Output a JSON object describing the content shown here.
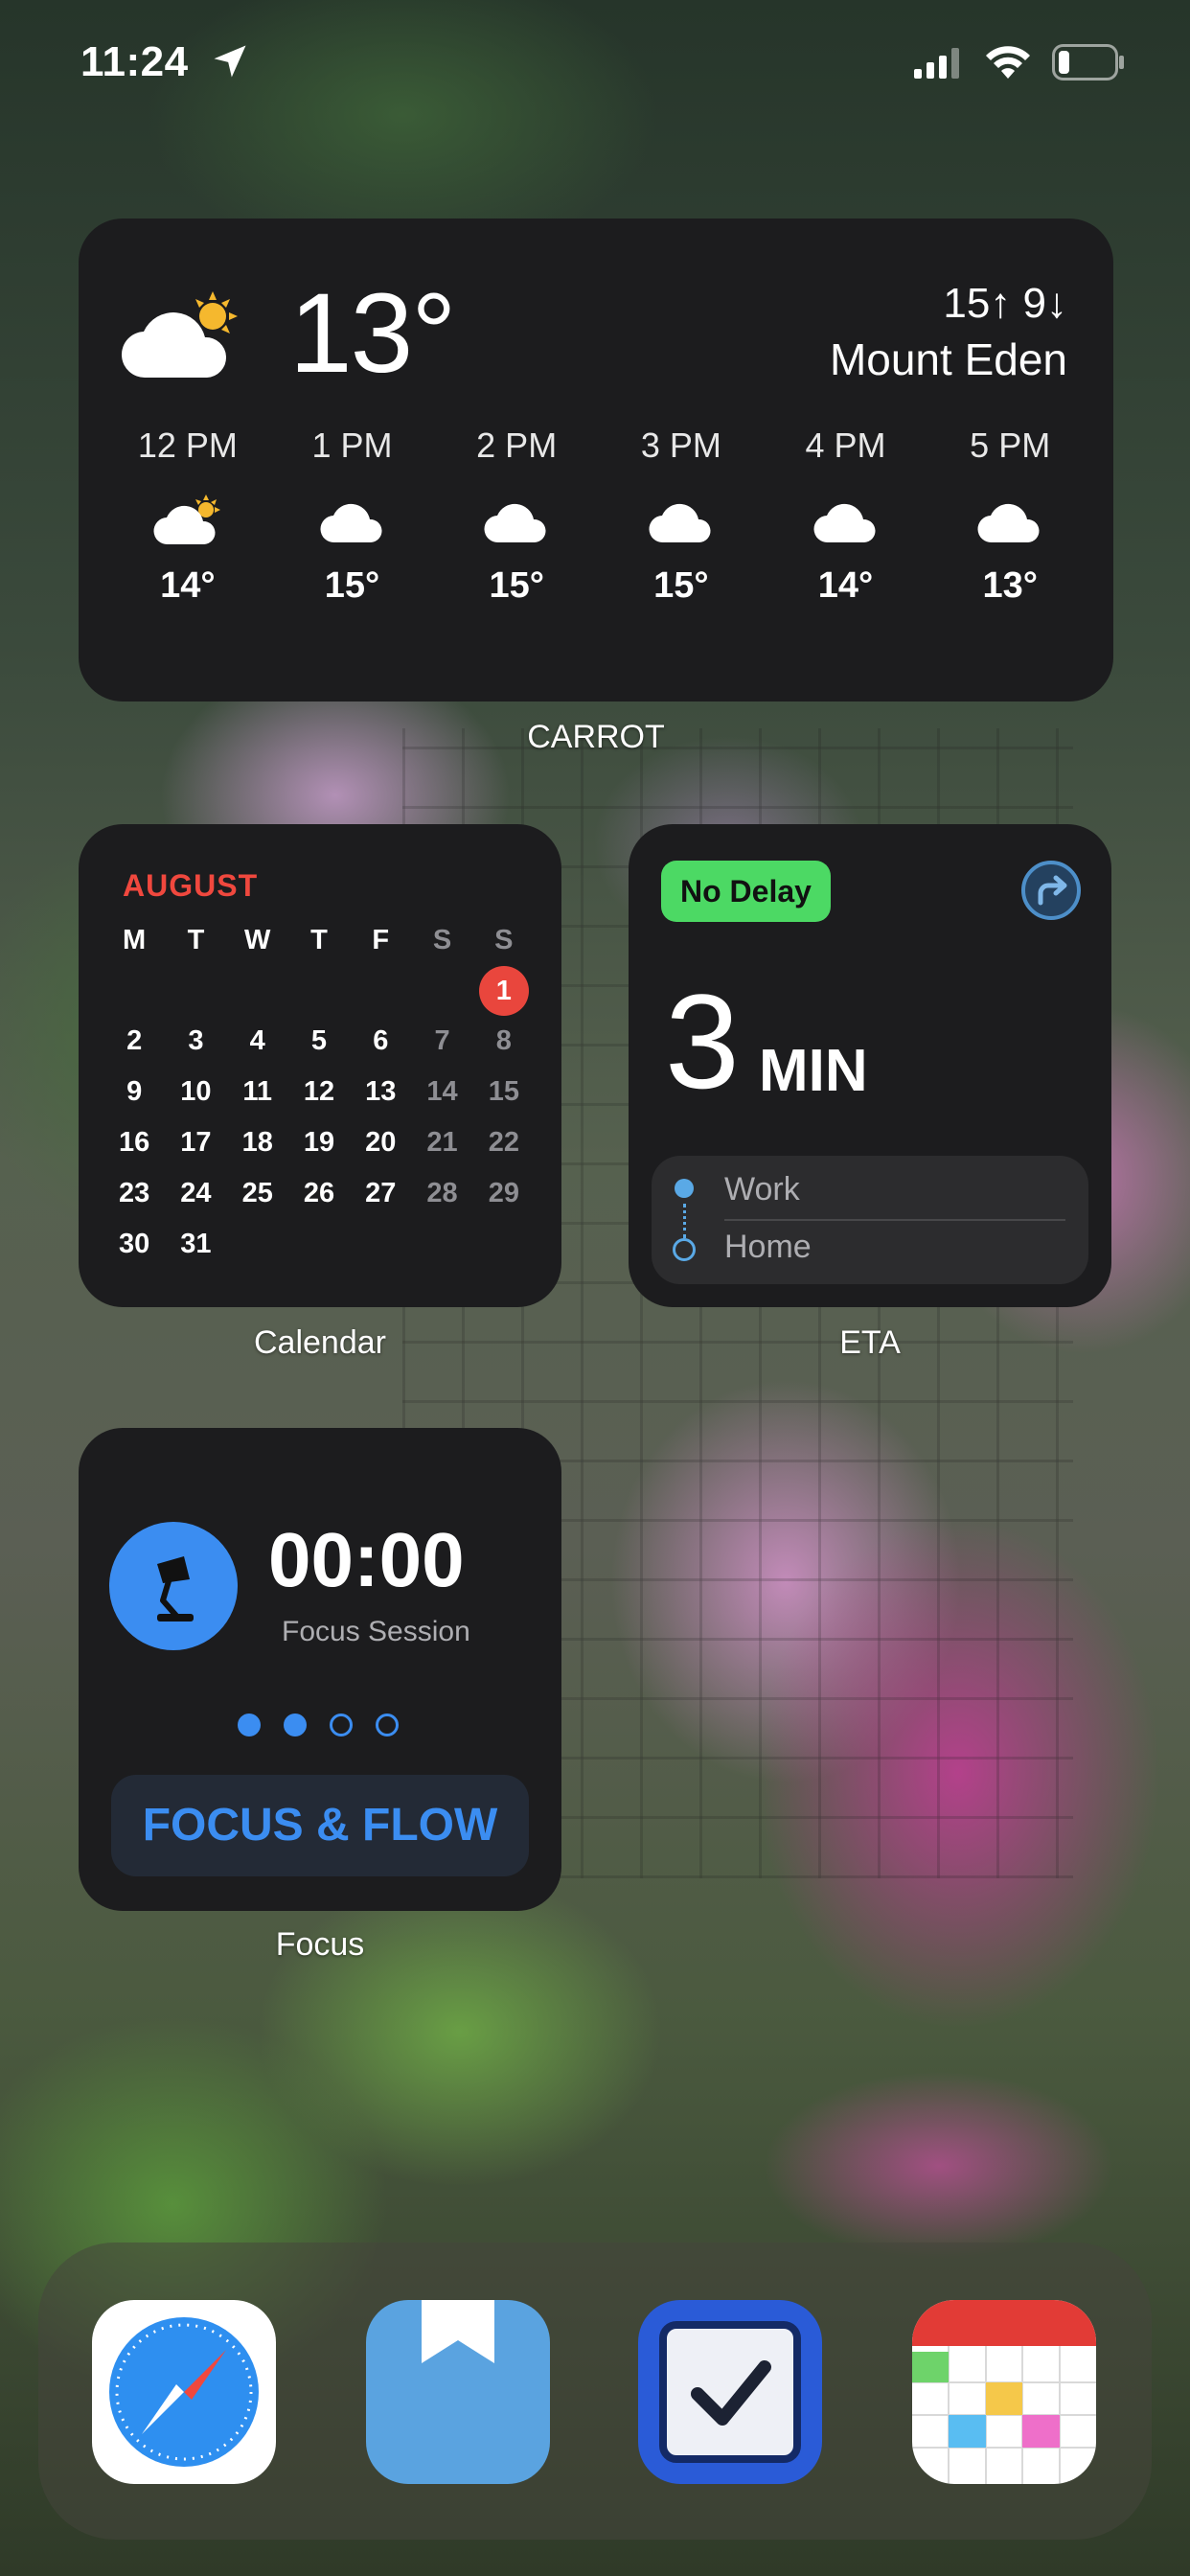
{
  "status_bar": {
    "time": "11:24",
    "location_icon": "location-arrow-icon",
    "signal_icon": "cellular-signal-icon",
    "wifi_icon": "wifi-icon",
    "battery_icon": "battery-low-icon"
  },
  "weather": {
    "app_label": "CARROT",
    "current_temp": "13°",
    "high_low": "15↑ 9↓",
    "location": "Mount Eden",
    "current_icon": "partly-cloudy-day-icon",
    "hours": [
      {
        "time": "12 PM",
        "icon": "partly-cloudy-day-icon",
        "temp": "14°"
      },
      {
        "time": "1 PM",
        "icon": "cloud-icon",
        "temp": "15°"
      },
      {
        "time": "2 PM",
        "icon": "cloud-icon",
        "temp": "15°"
      },
      {
        "time": "3 PM",
        "icon": "cloud-icon",
        "temp": "15°"
      },
      {
        "time": "4 PM",
        "icon": "cloud-icon",
        "temp": "14°"
      },
      {
        "time": "5 PM",
        "icon": "cloud-icon",
        "temp": "13°"
      }
    ]
  },
  "calendar": {
    "app_label": "Calendar",
    "month": "AUGUST",
    "weekdays": [
      "M",
      "T",
      "W",
      "T",
      "F",
      "S",
      "S"
    ],
    "weeks": [
      [
        "",
        "",
        "",
        "",
        "",
        "",
        "1"
      ],
      [
        "2",
        "3",
        "4",
        "5",
        "6",
        "7",
        "8"
      ],
      [
        "9",
        "10",
        "11",
        "12",
        "13",
        "14",
        "15"
      ],
      [
        "16",
        "17",
        "18",
        "19",
        "20",
        "21",
        "22"
      ],
      [
        "23",
        "24",
        "25",
        "26",
        "27",
        "28",
        "29"
      ],
      [
        "30",
        "31",
        "",
        "",
        "",
        "",
        ""
      ]
    ],
    "today": "1",
    "today_color": "#e9463d",
    "month_color": "#f0483e"
  },
  "eta": {
    "app_label": "ETA",
    "status": "No Delay",
    "status_color": "#4cd964",
    "minutes": "3",
    "unit": "MIN",
    "from": "Work",
    "to": "Home",
    "share_icon": "share-arrow-icon"
  },
  "focus": {
    "app_label": "Focus",
    "timer": "00:00",
    "caption": "Focus Session",
    "dots_filled": 2,
    "dots_total": 4,
    "button": "FOCUS & FLOW",
    "icon": "desk-lamp-icon",
    "accent": "#3b8df1"
  },
  "dock": {
    "apps": [
      {
        "name": "safari-app-icon"
      },
      {
        "name": "bookmark-app-icon"
      },
      {
        "name": "checkbox-app-icon"
      },
      {
        "name": "fantastical-calendar-app-icon"
      }
    ]
  }
}
